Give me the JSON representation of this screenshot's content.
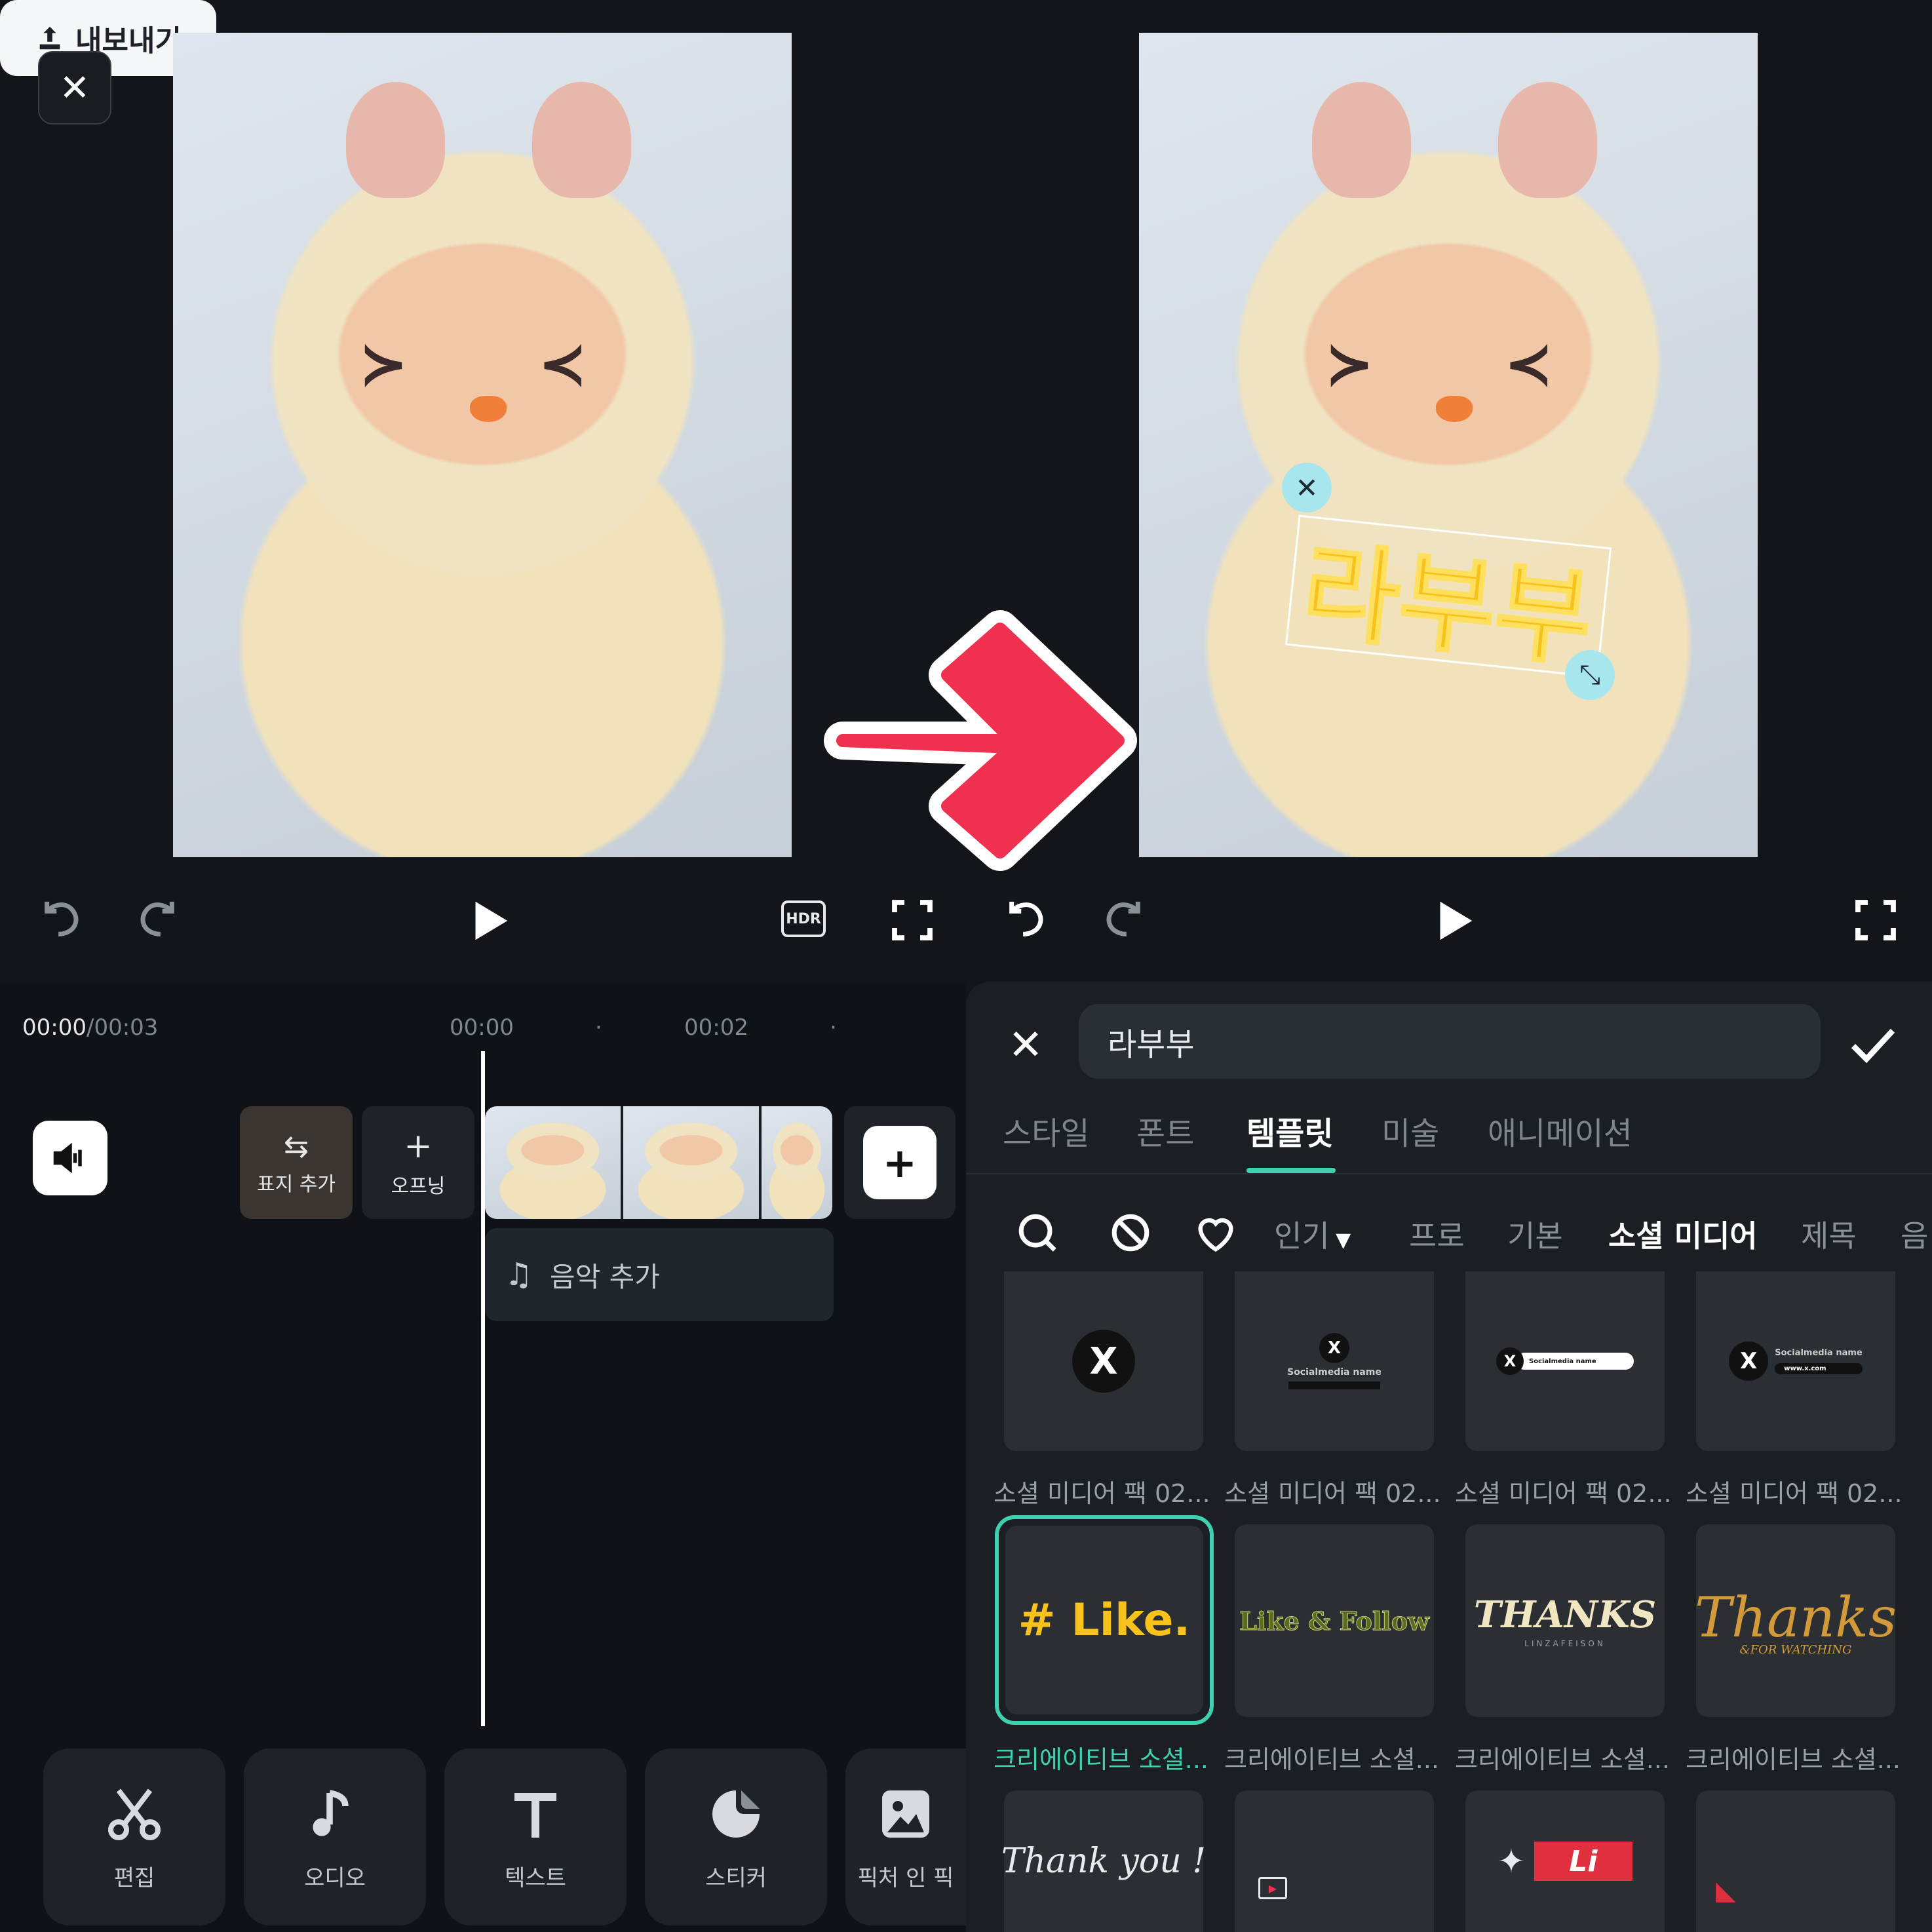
{
  "left_editor": {
    "export_label": "내보내기",
    "controls": [
      "undo-icon",
      "redo-icon",
      "play-icon",
      "hdr-icon",
      "fullscreen-icon"
    ]
  },
  "right_editor": {
    "overlay_text": "라부부",
    "text_color": "#f7c21b"
  },
  "timeline": {
    "current_time": "00:00",
    "total_time": "/00:03",
    "ruler": [
      "00:00",
      "00:02"
    ],
    "cover_label": "표지 추가",
    "opening_label": "오프닝",
    "music_label": "음악 추가"
  },
  "toolbar": {
    "items": [
      {
        "label": "편집",
        "icon": "scissors-icon"
      },
      {
        "label": "오디오",
        "icon": "music-note-icon"
      },
      {
        "label": "텍스트",
        "icon": "text-icon"
      },
      {
        "label": "스티커",
        "icon": "sticker-icon"
      },
      {
        "label": "픽처 인 픽",
        "icon": "picture-icon"
      }
    ]
  },
  "text_panel": {
    "input_value": "라부부",
    "tabs": [
      "스타일",
      "폰트",
      "템플릿",
      "미술",
      "애니메이션"
    ],
    "active_tab": "템플릿",
    "filters": [
      "인기",
      "프로",
      "기본",
      "소셜 미디어",
      "제목",
      "음"
    ],
    "active_filter": "소셜 미디어",
    "templates_row1": [
      {
        "caption": "소셜 미디어 팩 02..."
      },
      {
        "caption": "소셜 미디어 팩 02...",
        "text": "Socialmedia name"
      },
      {
        "caption": "소셜 미디어 팩 02...",
        "text": "Socialmedia name"
      },
      {
        "caption": "소셜 미디어 팩 02...",
        "text": "Socialmedia name",
        "sub": "www.x.com"
      }
    ],
    "templates_row2": [
      {
        "caption": "크리에이티브 소셜...",
        "text": "# Like."
      },
      {
        "caption": "크리에이티브 소셜...",
        "text": "Like & Follow"
      },
      {
        "caption": "크리에이티브 소셜...",
        "text": "THANKS",
        "sub": "LINZAFEISON"
      },
      {
        "caption": "크리에이티브 소셜...",
        "text": "Thanks",
        "sub": "&FOR WATCHING"
      }
    ],
    "templates_row3": [
      {
        "text": "Thank you !"
      },
      {
        "text": ""
      },
      {
        "text": "Li"
      },
      {
        "text": ""
      }
    ],
    "accent_color": "#3fd0b0"
  },
  "arrow_color": "#f0304f"
}
